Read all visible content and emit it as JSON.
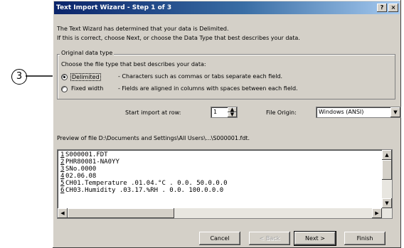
{
  "callout": {
    "number": "3"
  },
  "dialog": {
    "title": "Text Import Wizard - Step 1 of 3",
    "help_btn": "?",
    "close_btn": "×",
    "intro_line1": "The Text Wizard has determined that your data is Delimited.",
    "intro_line2": "If this is correct, choose Next, or choose the Data Type that best describes your data.",
    "group_label": "Original data type",
    "group_prompt": "Choose the file type that best describes your data:",
    "option_delimited": {
      "label": "Delimited",
      "desc": "- Characters such as commas or tabs separate each field.",
      "selected": true
    },
    "option_fixed": {
      "label": "Fixed width",
      "desc": "- Fields are aligned in columns with spaces between each field.",
      "selected": false
    },
    "start_row_label": "Start import at row:",
    "start_row_value": "1",
    "file_origin_label": "File Origin:",
    "file_origin_value": "Windows (ANSI)",
    "preview_label": "Preview of file D:\\Documents and Settings\\All Users\\...\\S000001.fdt.",
    "preview_rows": [
      {
        "num": "1",
        "text": "S000001.FDT"
      },
      {
        "num": "2",
        "text": "PHR80081-NA0YY"
      },
      {
        "num": "3",
        "text": "SNo.0000"
      },
      {
        "num": "4",
        "text": "02.06.08"
      },
      {
        "num": "5",
        "text": "CH01.Temperature    .01.04.°C    .    0.0.    50.0.0.0"
      },
      {
        "num": "6",
        "text": "CH03.Humidity       .03.17.%RH   .    0.0.   100.0.0.0"
      }
    ],
    "buttons": {
      "cancel": "Cancel",
      "back": "< Back",
      "next": "Next >",
      "finish": "Finish"
    }
  }
}
